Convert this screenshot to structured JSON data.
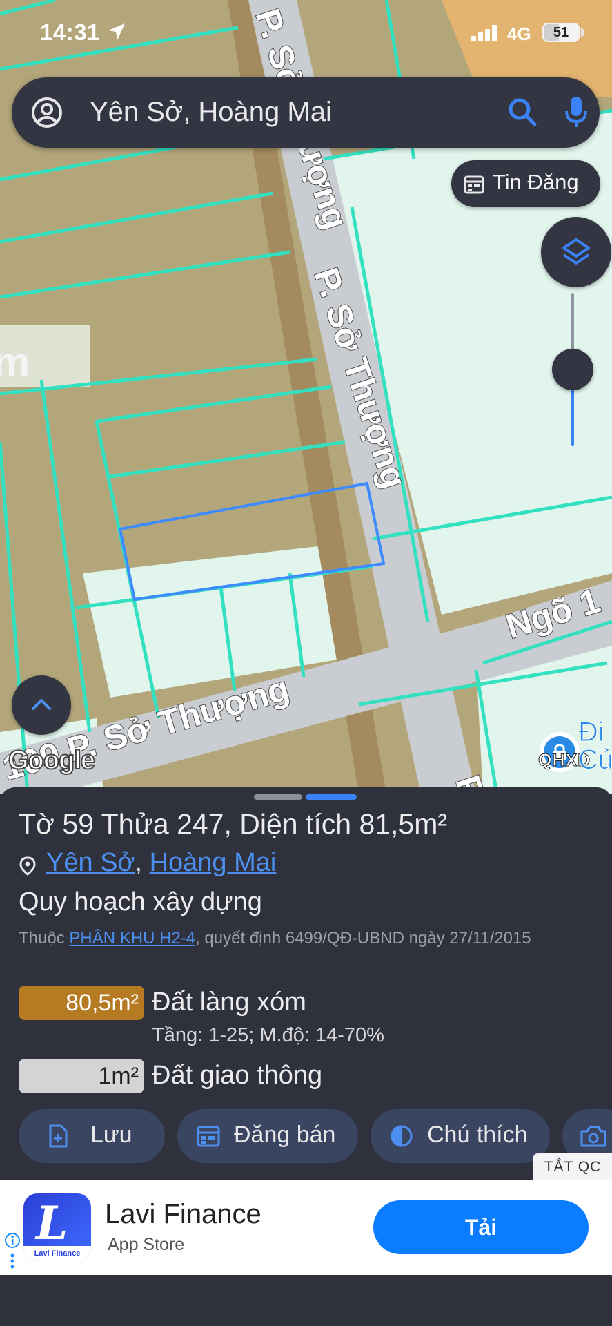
{
  "status_bar": {
    "time": "14:31",
    "network": "4G",
    "battery": "51"
  },
  "map": {
    "search_text": "Yên Sở, Hoàng Mai",
    "tin_dang_label": "Tin Đăng",
    "street_main": "P. Sở Thượng",
    "street_top": "P. Sở Thượng",
    "street_bottom": "109 P. Sở Thượng",
    "street_ngo": "Ngõ 1",
    "google_logo": "Google",
    "qhxd_label": "QHXD",
    "poi_text": "Đi",
    "poi_text_2": "Cử",
    "label_p": "P",
    "label_m": "m"
  },
  "sheet": {
    "title": "Tờ 59 Thửa 247, Diện tích 81,5m²",
    "location": {
      "ward": "Yên Sở",
      "separator": ",",
      "district": "Hoàng Mai"
    },
    "plan_title": "Quy hoạch xây dựng",
    "plan_desc": {
      "prefix": "Thuộc ",
      "link": "PHÂN KHU H2-4",
      "suffix": ", quyết định 6499/QĐ-UBND ngày 27/11/2015"
    },
    "areas": [
      {
        "size": "80,5m²",
        "name": "Đất làng xóm",
        "extra": "Tầng: 1-25; M.độ: 14-70%",
        "color": "#b57a22"
      },
      {
        "size": "1m²",
        "name": "Đất giao thông",
        "color": "#d4d4d6"
      }
    ],
    "actions": {
      "save": "Lưu",
      "sell": "Đăng bán",
      "legend": "Chú thích"
    },
    "hide_ads": "TẮT QC"
  },
  "ad": {
    "app_name": "Lavi Finance",
    "store": "App Store",
    "install": "Tải",
    "icon_sub": "Lavi Finance"
  },
  "colors": {
    "accent": "#3b82f6",
    "panel": "#333642",
    "sheet_bg": "#2f323d",
    "parcel_outline": "#3d8bff",
    "plot_lines": "#33e0c0"
  }
}
